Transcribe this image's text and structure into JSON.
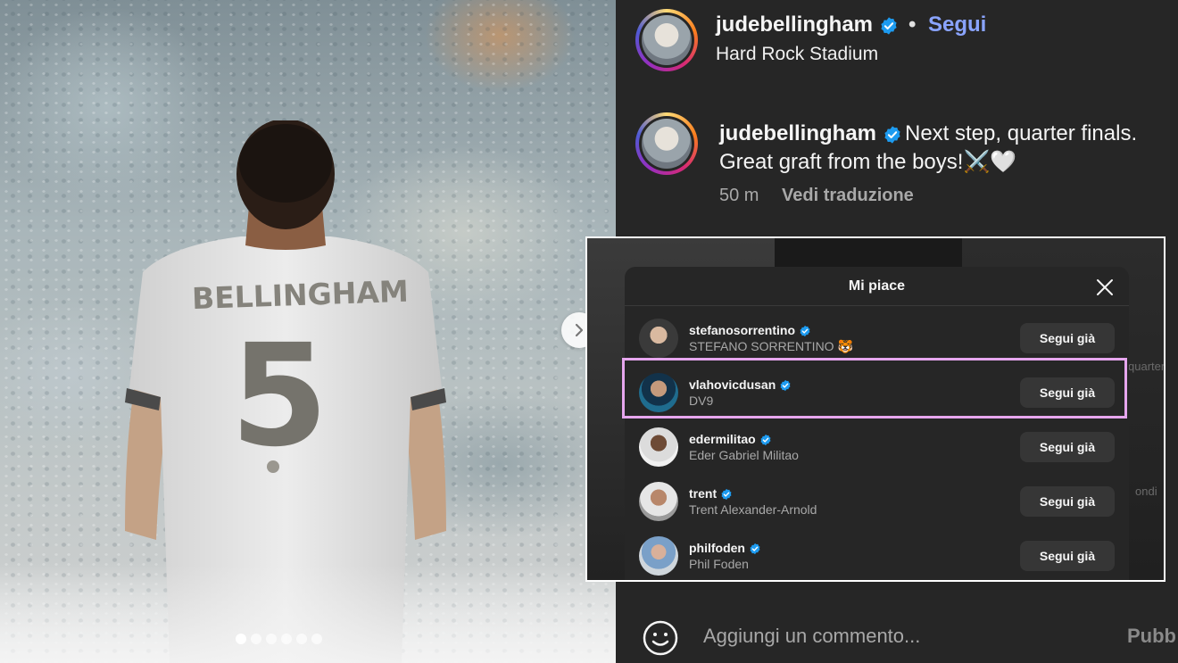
{
  "post": {
    "author": "judebellingham",
    "separator": "•",
    "follow_label": "Segui",
    "location": "Hard Rock Stadium",
    "caption_line1": "Next step, quarter finals.",
    "caption_line2": "Great graft from the boys!⚔️🤍",
    "time": "50 m",
    "translate_label": "Vedi traduzione",
    "carousel": {
      "count": 6,
      "active_index": 0
    },
    "jersey_name": "BELLINGHAM",
    "jersey_number": "5"
  },
  "likes_modal": {
    "title": "Mi piace",
    "highlighted_index": 1,
    "users": [
      {
        "username": "stefanosorrentino",
        "full_name": "STEFANO SORRENTINO 🐯",
        "button": "Segui già",
        "verified": true
      },
      {
        "username": "vlahovicdusan",
        "full_name": "DV9",
        "button": "Segui già",
        "verified": true
      },
      {
        "username": "edermilitao",
        "full_name": "Eder Gabriel Militao",
        "button": "Segui già",
        "verified": true
      },
      {
        "username": "trent",
        "full_name": "Trent Alexander-Arnold",
        "button": "Segui già",
        "verified": true
      },
      {
        "username": "philfoden",
        "full_name": "Phil Foden",
        "button": "Segui già",
        "verified": true
      }
    ],
    "background_fragments": [
      "quarter",
      "ondi"
    ]
  },
  "comment": {
    "placeholder": "Aggiungi un commento...",
    "publish_label": "Pubb"
  },
  "icons": {
    "verified": "verified-badge-icon",
    "close": "close-icon",
    "next": "chevron-right-icon",
    "emoji": "emoji-icon"
  },
  "colors": {
    "background": "#262626",
    "follow_link": "#8aa4ff",
    "verified": "#1d9bf0",
    "highlight_border": "#e6a6ee",
    "follow_button": "#363636"
  }
}
